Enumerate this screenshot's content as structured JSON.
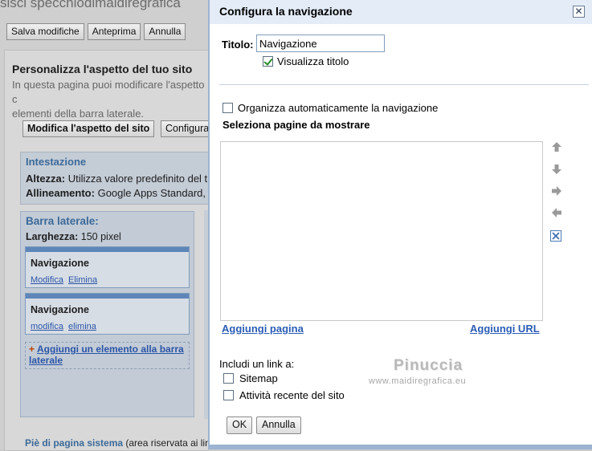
{
  "background": {
    "site_title": "sisci specchiodimaidiregrafica",
    "toolbar": [
      "Salva modifiche",
      "Anteprima",
      "Annulla"
    ],
    "heading": "Personalizza l'aspetto del tuo sito",
    "description_line1": "In questa pagina puoi modificare l'aspetto c",
    "description_line2": "elementi della barra laterale.",
    "tab_buttons": [
      "Modifica l'aspetto del sito",
      "Configura"
    ],
    "header_section": {
      "title": "Intestazione",
      "height_label": "Altezza:",
      "height_value": "Utilizza valore predefinito del t",
      "align_label": "Allineamento:",
      "align_value": "Google Apps Standard,"
    },
    "sidebar": {
      "title": "Barra laterale:",
      "width_label": "Larghezza:",
      "width_value": "150 pixel",
      "gadgets": [
        {
          "title": "Navigazione",
          "links": [
            "Modifica",
            "Elimina"
          ]
        },
        {
          "title": "Navigazione",
          "links": [
            "modifica",
            "elimina"
          ]
        }
      ],
      "add_element": "Aggiungi un elemento alla barra laterale"
    },
    "footer_label": "Piè di pagina sistema",
    "footer_note": "(area riservata ai lin"
  },
  "dialog": {
    "title": "Configura la navigazione",
    "close_glyph": "✕",
    "title_label": "Titolo:",
    "title_value": "Navigazione",
    "show_title_label": "Visualizza titolo",
    "show_title_checked": true,
    "auto_organize_label": "Organizza automaticamente la navigazione",
    "auto_organize_checked": false,
    "select_pages_label": "Seleziona pagine da mostrare",
    "side_icons": [
      "arrow-up-icon",
      "arrow-down-icon",
      "arrow-right-icon",
      "arrow-left-icon",
      "remove-icon"
    ],
    "add_page_link": "Aggiungi pagina",
    "add_url_link": "Aggiungi URL",
    "include_link_label": "Includi un link a:",
    "include_options": [
      {
        "label": "Sitemap",
        "checked": false
      },
      {
        "label": "Attività recente del sito",
        "checked": false
      }
    ],
    "ok_button": "OK",
    "cancel_button": "Annulla"
  },
  "watermark": {
    "name": "Pinuccia",
    "url": "www.maidiregrafica.eu"
  },
  "colors": {
    "dialog_header_bg": "#e3ecf7",
    "link_blue": "#2b5db5",
    "dialog_border": "#9cb3d1",
    "checkmark_green": "#2a8a2a"
  }
}
